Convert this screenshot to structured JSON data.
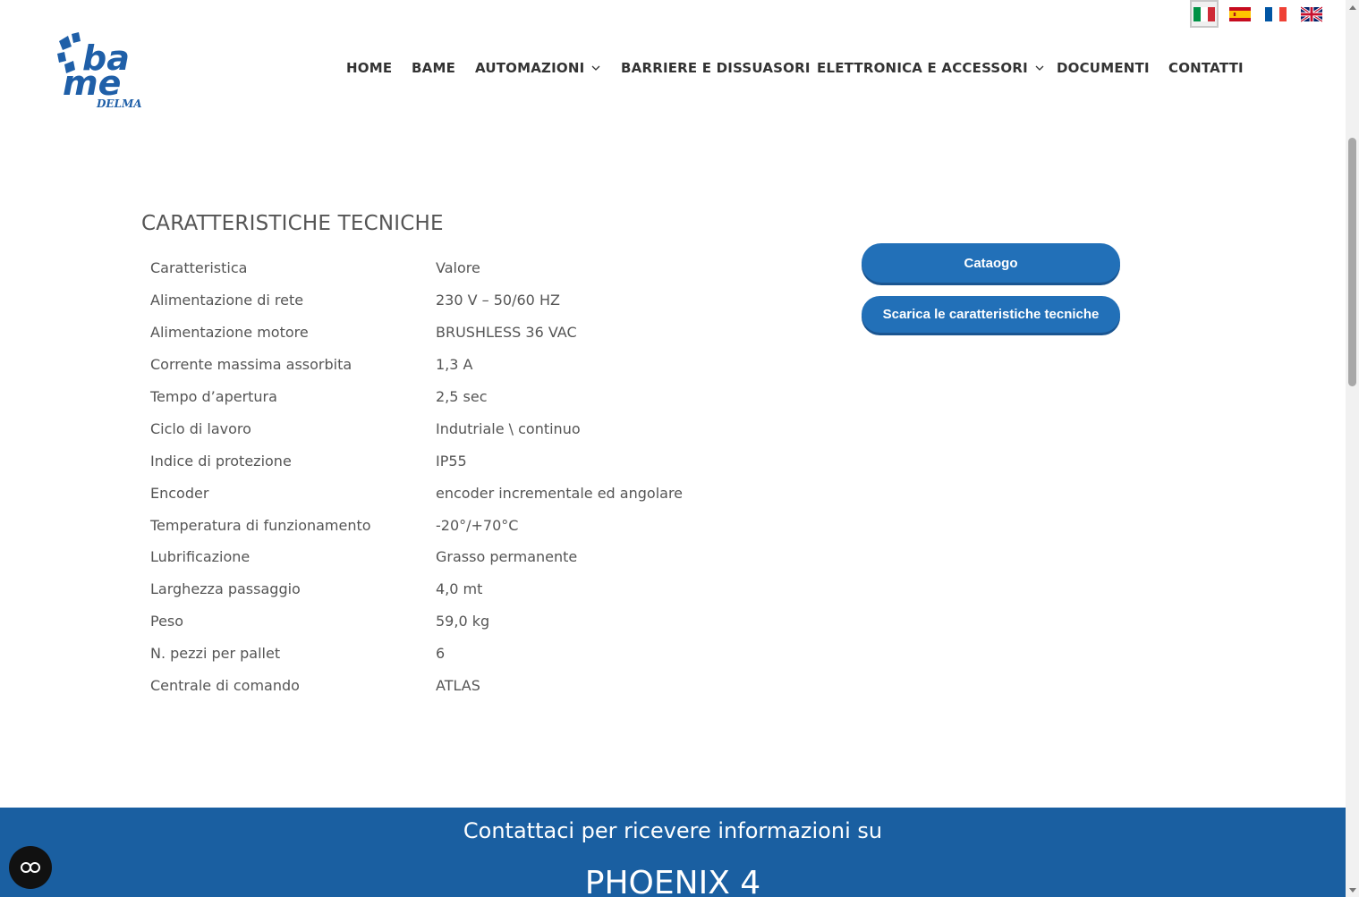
{
  "header": {
    "logo": {
      "text_top": "ba",
      "text_mid": "me",
      "text_sub": "DELMA",
      "icon": "bame-logo"
    },
    "nav": [
      {
        "label": "HOME",
        "has_dropdown": false
      },
      {
        "label": "BAME",
        "has_dropdown": false
      },
      {
        "label": "AUTOMAZIONI",
        "has_dropdown": true
      },
      {
        "label": "BARRIERE E DISSUASORI",
        "has_dropdown": false
      },
      {
        "label": "ELETTRONICA E ACCESSORI",
        "has_dropdown": true
      },
      {
        "label": "DOCUMENTI",
        "has_dropdown": false
      },
      {
        "label": "CONTATTI",
        "has_dropdown": false
      }
    ],
    "languages": [
      "it",
      "es",
      "fr",
      "en"
    ],
    "active_language": "it"
  },
  "specs": {
    "title": "CARATTERISTICHE TECNICHE",
    "rows": [
      {
        "key": "Caratteristica",
        "value": "Valore"
      },
      {
        "key": "Alimentazione di rete",
        "value": "230 V – 50/60 HZ"
      },
      {
        "key": "Alimentazione motore",
        "value": "BRUSHLESS 36 VAC"
      },
      {
        "key": "Corrente massima assorbita",
        "value": "1,3 A"
      },
      {
        "key": "Tempo d’apertura",
        "value": "2,5 sec"
      },
      {
        "key": "Ciclo di lavoro",
        "value": "Indutriale \\ continuo"
      },
      {
        "key": "Indice di protezione",
        "value": "IP55"
      },
      {
        "key": "Encoder",
        "value": "encoder incrementale ed angolare"
      },
      {
        "key": "Temperatura di funzionamento",
        "value": "-20°/+70°C"
      },
      {
        "key": "Lubrificazione",
        "value": "Grasso permanente"
      },
      {
        "key": "Larghezza passaggio",
        "value": "4,0 mt"
      },
      {
        "key": "Peso",
        "value": "59,0 kg"
      },
      {
        "key": "N. pezzi per pallet",
        "value": "6"
      },
      {
        "key": "Centrale di comando",
        "value": "ATLAS"
      }
    ]
  },
  "buttons": {
    "catalog_label": "Cataogo",
    "download_label": "Scarica le caratteristiche tecniche"
  },
  "band": {
    "line1": "Contattaci per ricevere informazioni su",
    "line2": "PHOENIX 4"
  },
  "colors": {
    "accent": "#2270b8",
    "band": "#1a5fa1",
    "text": "#555555",
    "nav_text": "#333333"
  }
}
